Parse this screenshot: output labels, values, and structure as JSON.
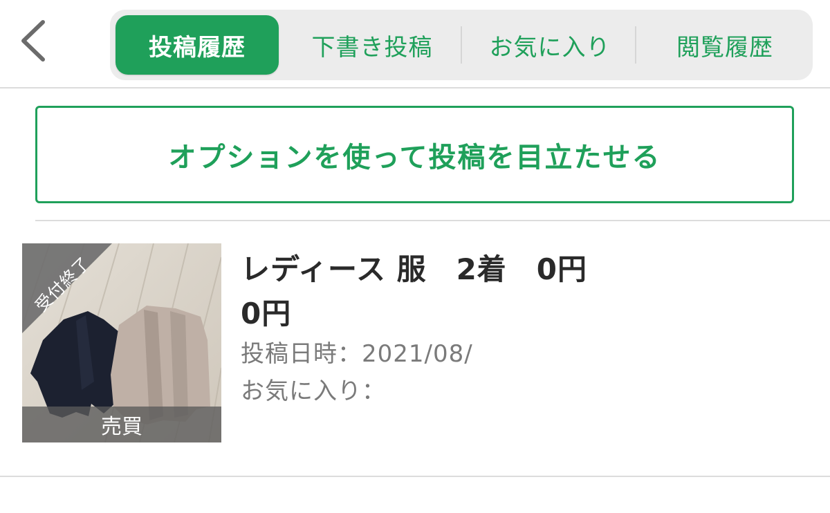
{
  "header": {
    "tabs": [
      {
        "label": "投稿履歴",
        "active": true
      },
      {
        "label": "下書き投稿",
        "active": false
      },
      {
        "label": "お気に入り",
        "active": false
      },
      {
        "label": "閲覧履歴",
        "active": false
      }
    ],
    "back_icon": "chevron-left-icon"
  },
  "option_button": {
    "label": "オプションを使って投稿を目立たせる"
  },
  "posts": [
    {
      "status_ribbon": "受付終了",
      "category_label": "売買",
      "title_line1": "レディース 服　2着　0円",
      "title_line2": "0円",
      "posted_at": "投稿日時：2021/08/",
      "favorites": "お気に入り："
    }
  ],
  "colors": {
    "accent": "#1fa05a",
    "tab_background": "#ececec",
    "text_primary": "#2a2a2a",
    "text_secondary": "#7a7a7a",
    "divider": "#dcdcdc"
  }
}
